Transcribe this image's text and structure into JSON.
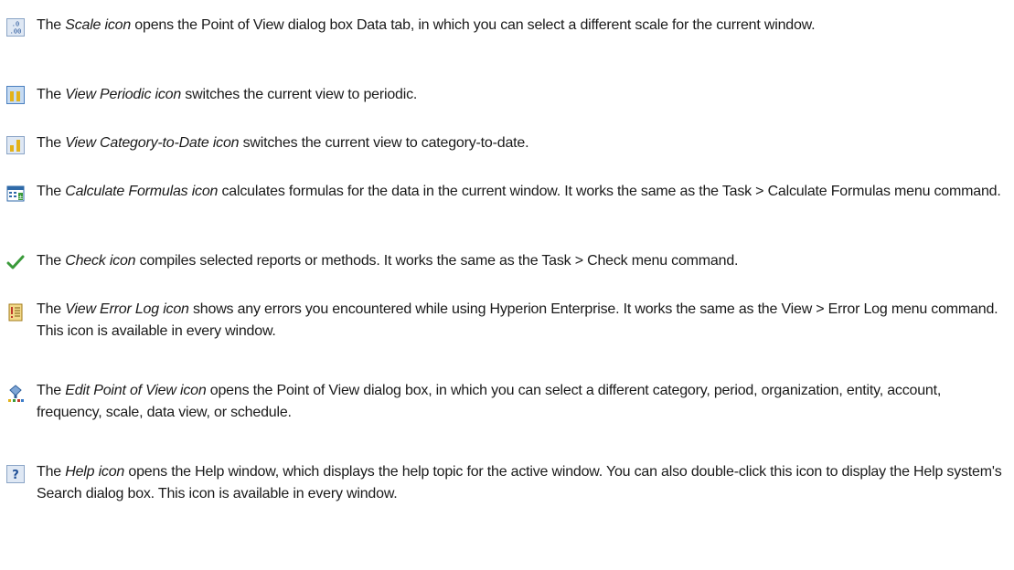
{
  "entries": [
    {
      "icon": "scale-icon",
      "name": "Scale icon",
      "pre": "The ",
      "post": " opens the Point of View dialog box Data tab, in which you can select a different scale for the current window."
    },
    {
      "icon": "view-periodic-icon",
      "name": "View Periodic icon",
      "pre": "The ",
      "post": " switches the current view to periodic."
    },
    {
      "icon": "view-category-to-date-icon",
      "name": "View Category-to-Date icon",
      "pre": "The ",
      "post": " switches the current view to category-to-date."
    },
    {
      "icon": "calculate-formulas-icon",
      "name": "Calculate Formulas icon",
      "pre": "The ",
      "post": " calculates formulas for the data in the current window. It works the same as the Task > Calculate Formulas menu command."
    },
    {
      "icon": "check-icon",
      "name": "Check icon",
      "pre": "The ",
      "post": " compiles selected reports or methods. It works the same as the Task > Check menu command."
    },
    {
      "icon": "view-error-log-icon",
      "name": "View Error Log icon",
      "pre": "The ",
      "post": " shows any errors you encountered while using Hyperion Enterprise. It works the same as the View > Error Log menu command. This icon is available in every window."
    },
    {
      "icon": "edit-point-of-view-icon",
      "name": "Edit Point of View icon",
      "pre": "The ",
      "post": " opens the Point of View dialog box, in which you can select a different category, period, organization, entity, account, frequency, scale, data view, or schedule."
    },
    {
      "icon": "help-icon",
      "name": "Help icon",
      "pre": "The ",
      "post": " opens the Help window, which displays the help topic for the active window. You can also double-click this icon to display the Help system's Search dialog box. This icon is available in every window."
    }
  ],
  "colors": {
    "text": "#1a1a1a",
    "icon_blue": "#3b7dc9",
    "icon_gold": "#e3b21a",
    "icon_green": "#3a9a3a",
    "icon_red": "#c0392b"
  }
}
